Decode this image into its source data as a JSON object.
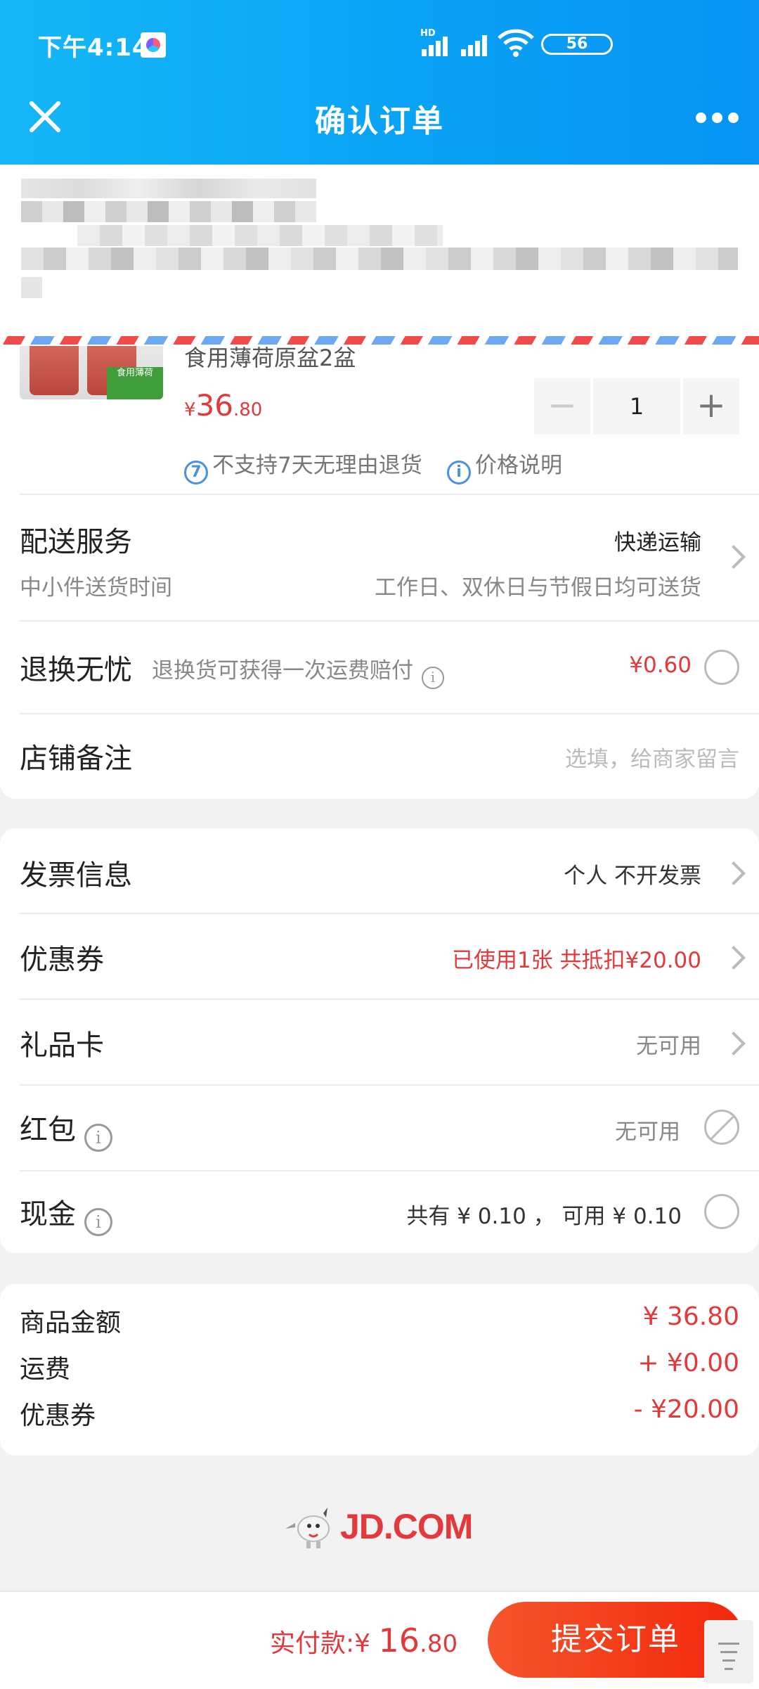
{
  "status_bar": {
    "time": "下午4:14",
    "battery": "56",
    "network": "HD"
  },
  "nav": {
    "title": "确认订单"
  },
  "product": {
    "title": "食用薄荷原盆2盆",
    "image_tag": "食用薄荷",
    "price_currency": "¥",
    "price_int": "36",
    "price_dec": ".80",
    "quantity": "1",
    "minus": "−",
    "plus": "+",
    "no_return": "不支持7天无理由退货",
    "price_note": "价格说明"
  },
  "delivery": {
    "label": "配送服务",
    "method": "快递运输",
    "sub_label": "中小件送货时间",
    "sub_value": "工作日、双休日与节假日均可送货"
  },
  "return_insurance": {
    "label": "退换无忧",
    "desc": "退换货可获得一次运费赔付",
    "price": "¥0.60"
  },
  "shop_note": {
    "label": "店铺备注",
    "placeholder": "选填，给商家留言"
  },
  "invoice": {
    "label": "发票信息",
    "value": "个人 不开发票"
  },
  "coupon": {
    "label": "优惠券",
    "value": "已使用1张 共抵扣¥20.00"
  },
  "gift_card": {
    "label": "礼品卡",
    "value": "无可用"
  },
  "red_packet": {
    "label": "红包",
    "value": "无可用"
  },
  "cash": {
    "label": "现金",
    "value": "共有 ¥ 0.10 ， 可用 ¥ 0.10"
  },
  "summary": {
    "goods_label": "商品金额",
    "goods_value": "¥ 36.80",
    "freight_label": "运费",
    "freight_value": "+ ¥0.00",
    "coupon_label": "优惠券",
    "coupon_value": "- ¥20.00"
  },
  "footer": {
    "logo": "JD.COM",
    "pay_label": "实付款:",
    "pay_currency": "¥ ",
    "pay_int": "16",
    "pay_dec": ".80",
    "submit": "提交订单"
  },
  "colors": {
    "accent_red": "#e4393c",
    "header_blue": "#0aa2f5",
    "submit_red": "#f2270c"
  },
  "icons": [
    "close-icon",
    "more-icon",
    "minus-icon",
    "plus-icon",
    "no-return-icon",
    "info-icon",
    "chevron-right-icon",
    "radio-icon",
    "disabled-icon",
    "jd-dog-icon",
    "scroll-handle-icon"
  ]
}
